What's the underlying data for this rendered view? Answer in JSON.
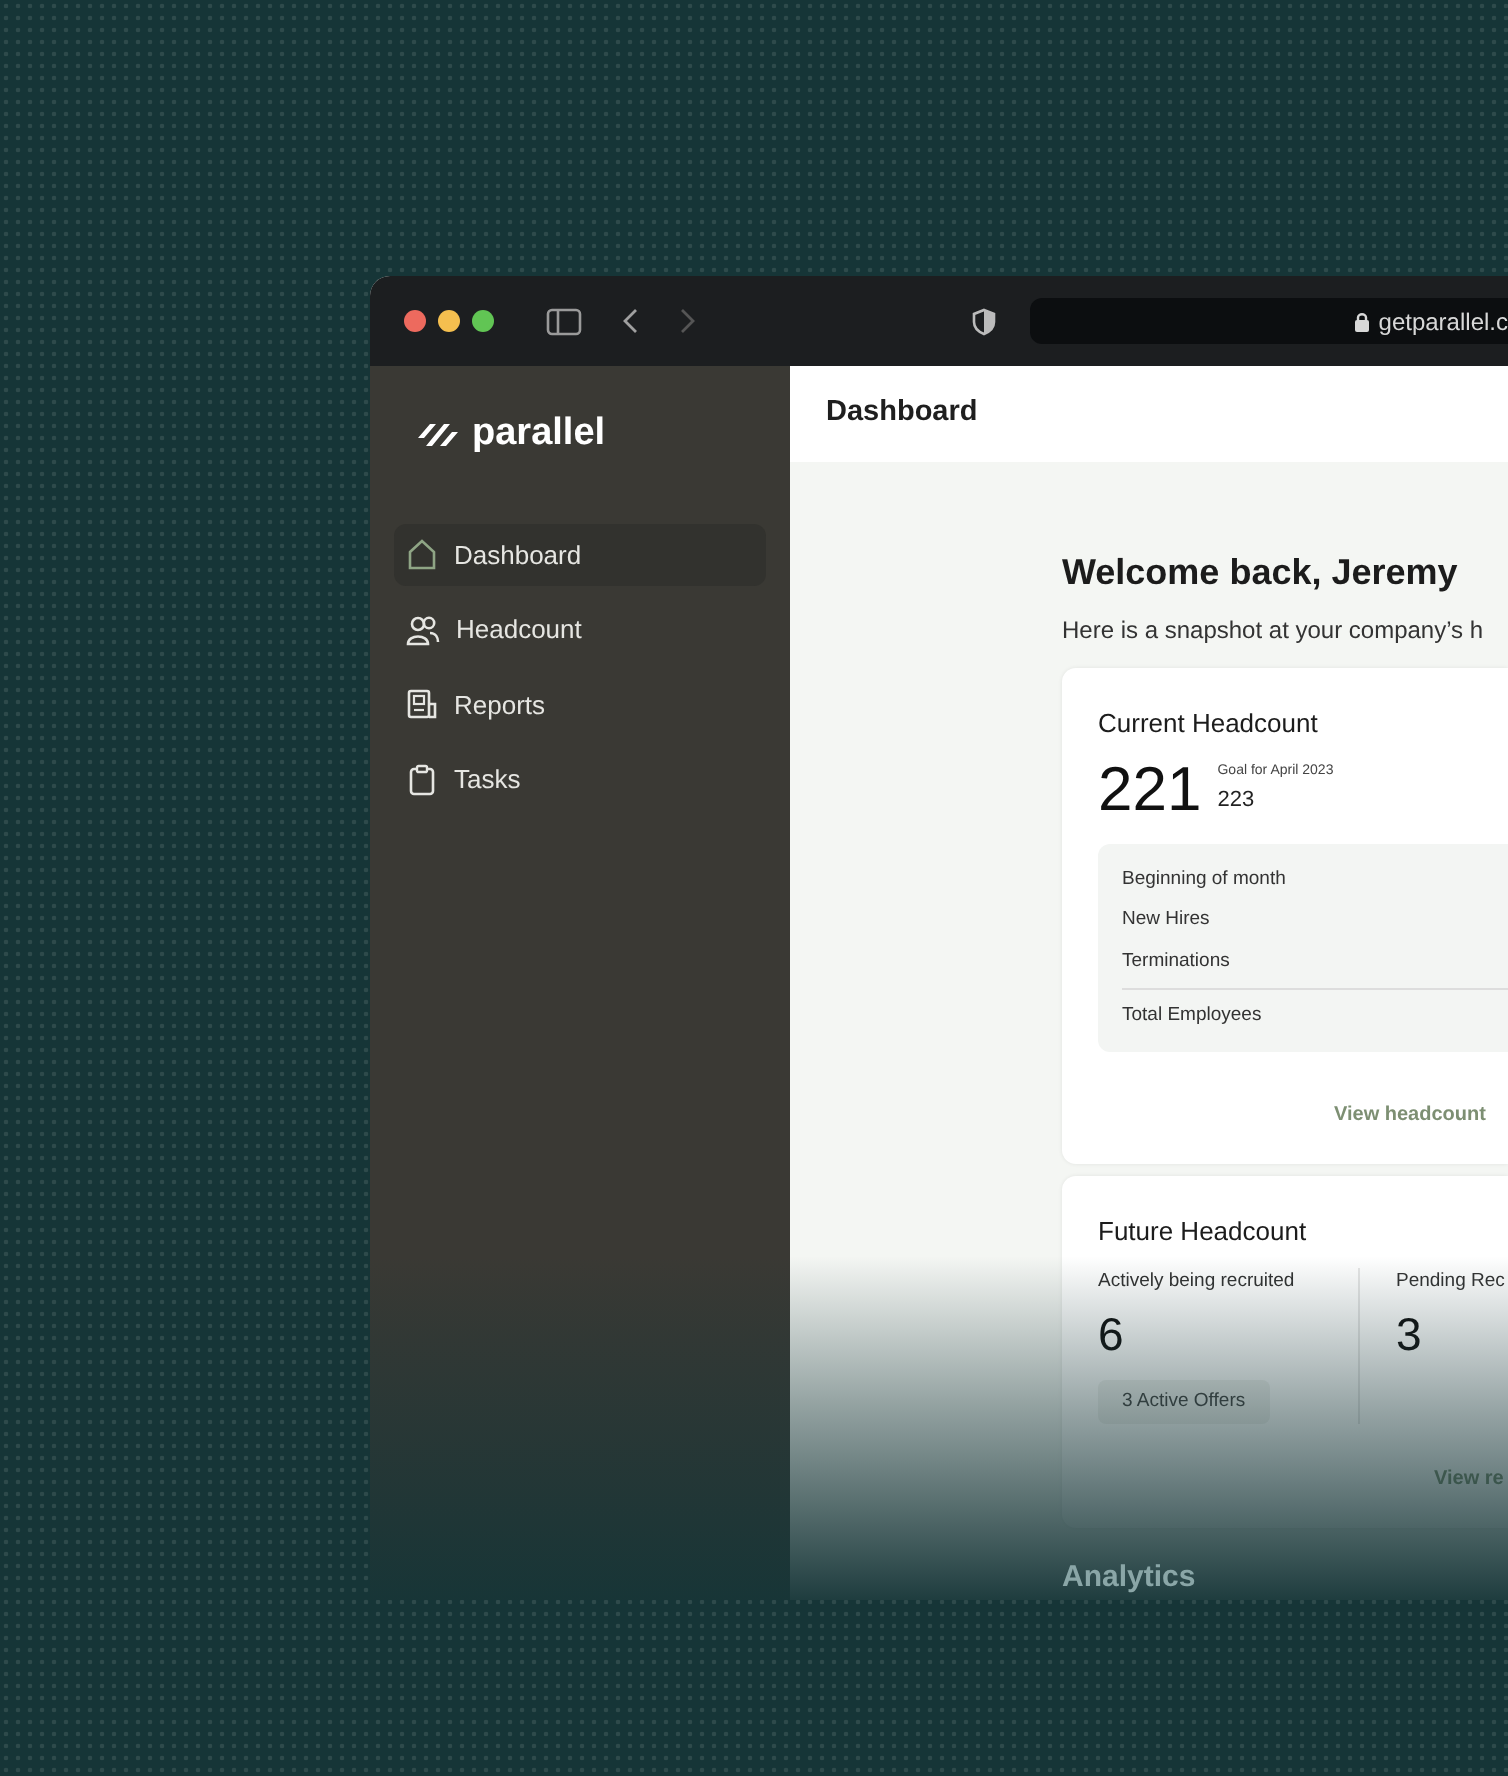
{
  "browser": {
    "url": "getparallel.c"
  },
  "sidebar": {
    "logo": "parallel",
    "items": [
      {
        "label": "Dashboard",
        "selected": true
      },
      {
        "label": "Headcount",
        "selected": false
      },
      {
        "label": "Reports",
        "selected": false
      },
      {
        "label": "Tasks",
        "selected": false
      }
    ]
  },
  "header": {
    "title": "Dashboard"
  },
  "welcome": {
    "title": "Welcome back, Jeremy",
    "subtitle": "Here is a snapshot at your company’s h"
  },
  "current_headcount": {
    "title": "Current Headcount",
    "count": "221",
    "goal_label": "Goal for April 2023",
    "goal": "223",
    "rows": [
      {
        "label": "Beginning of month",
        "kind": "line"
      },
      {
        "label": "New Hires",
        "kind": "line"
      },
      {
        "label": "Terminations",
        "kind": "line"
      },
      {
        "label": "Total Employees",
        "kind": "total"
      }
    ],
    "link": "View headcount"
  },
  "future_headcount": {
    "title": "Future Headcount",
    "columns": [
      {
        "label": "Actively being recruited",
        "count": "6",
        "badge": "3 Active Offers"
      },
      {
        "label": "Pending Rec",
        "count": "3"
      }
    ],
    "link": "View re"
  },
  "analytics": {
    "title": "Analytics"
  }
}
